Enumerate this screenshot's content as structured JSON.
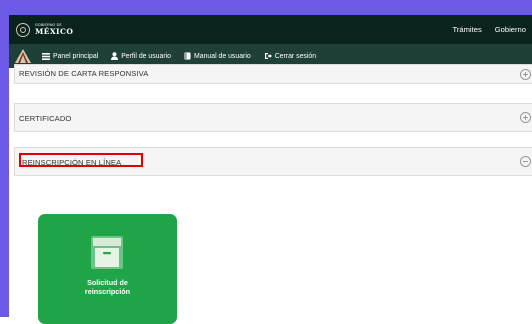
{
  "header": {
    "logo_small": "GOBIERNO DE",
    "logo_big": "MÉXICO",
    "nav": [
      "Trámites",
      "Gobierno"
    ]
  },
  "subnav": {
    "items": [
      {
        "label": "Panel principal",
        "icon": "menu-icon"
      },
      {
        "label": "Perfil de usuario",
        "icon": "user-icon"
      },
      {
        "label": "Manual de usuario",
        "icon": "book-icon"
      },
      {
        "label": "Cerrar sesión",
        "icon": "logout-icon"
      }
    ]
  },
  "accordion": [
    {
      "title": "REVISIÓN DE CARTA RESPONSIVA",
      "state": "collapsed"
    },
    {
      "title": "CERTIFICADO",
      "state": "collapsed"
    },
    {
      "title": "REINSCRIPCIÓN EN LÍNEA",
      "state": "expanded"
    }
  ],
  "card": {
    "label_line1": "Solicitud de",
    "label_line2": "reinscripción",
    "icon": "archive-box-icon"
  },
  "colors": {
    "frame": "#6c5ae6",
    "header": "#0b231e",
    "subnav": "#1f4039",
    "card": "#1fa547",
    "highlight": "#e00000"
  }
}
